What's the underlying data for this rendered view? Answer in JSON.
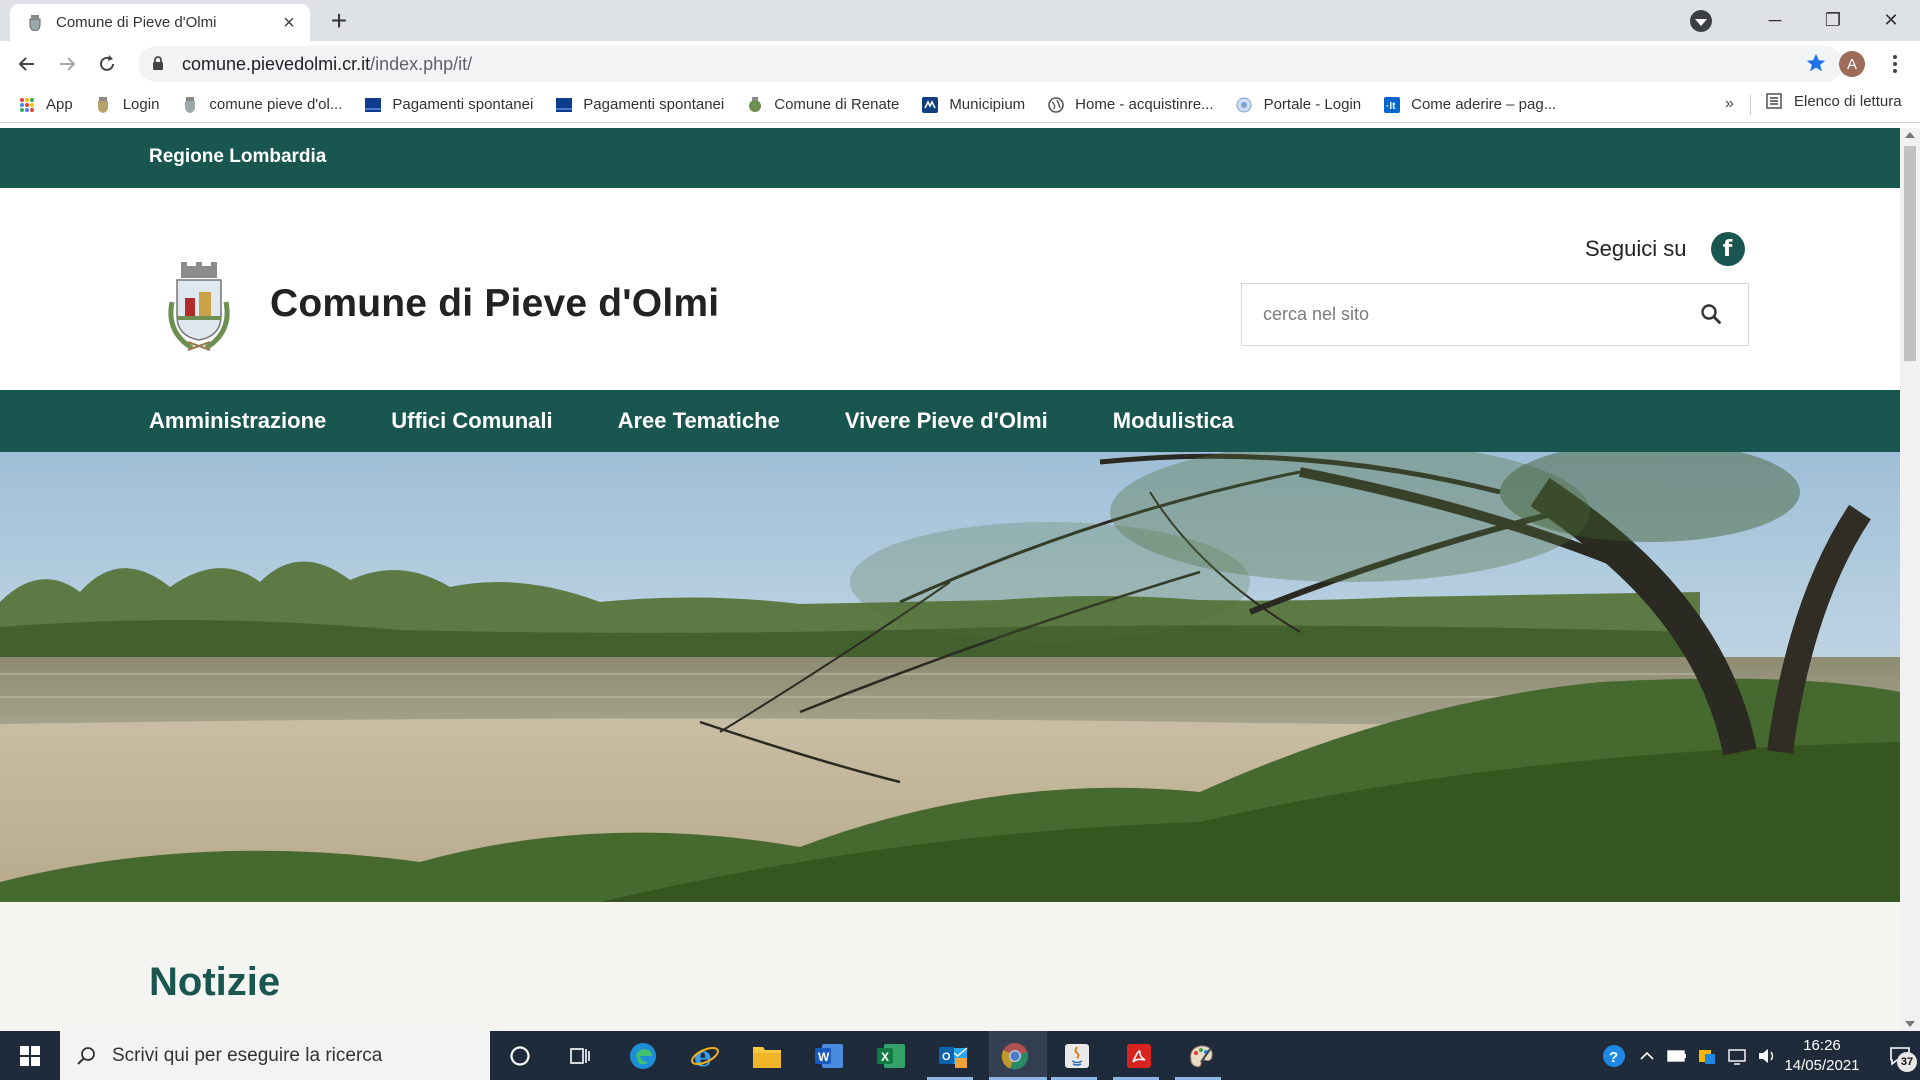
{
  "browser": {
    "tab_title": "Comune di Pieve d'Olmi",
    "url_host": "comune.pievedolmi.cr.it",
    "url_path": "/index.php/it/",
    "profile_initial": "A",
    "bookmarks": [
      {
        "label": "App",
        "icon": "apps-grid-icon"
      },
      {
        "label": "Login",
        "icon": "crest-icon"
      },
      {
        "label": "comune pieve d'ol...",
        "icon": "crest-icon"
      },
      {
        "label": "Pagamenti spontanei",
        "icon": "payment-icon"
      },
      {
        "label": "Pagamenti spontanei",
        "icon": "payment-icon"
      },
      {
        "label": "Comune di Renate",
        "icon": "crest-icon"
      },
      {
        "label": "Municipium",
        "icon": "municipium-icon"
      },
      {
        "label": "Home - acquistinre...",
        "icon": "globe-icon"
      },
      {
        "label": "Portale - Login",
        "icon": "portal-icon"
      },
      {
        "label": "Come aderire – pag...",
        "icon": "pagopa-icon"
      }
    ],
    "bookmarks_more": "»",
    "reading_list": "Elenco di lettura"
  },
  "site": {
    "region_link": "Regione Lombardia",
    "title": "Comune di Pieve d'Olmi",
    "follow_label": "Seguici su",
    "search_placeholder": "cerca nel sito",
    "nav": [
      "Amministrazione",
      "Uffici Comunali",
      "Aree Tematiche",
      "Vivere Pieve d'Olmi",
      "Modulistica"
    ],
    "news_heading": "Notizie",
    "colors": {
      "brand_green": "#1a5650",
      "page_bg": "#f4f5f1"
    }
  },
  "taskbar": {
    "search_text": "Scrivi qui per eseguire la ricerca",
    "time": "16:26",
    "date": "14/05/2021",
    "notification_count": "37"
  }
}
